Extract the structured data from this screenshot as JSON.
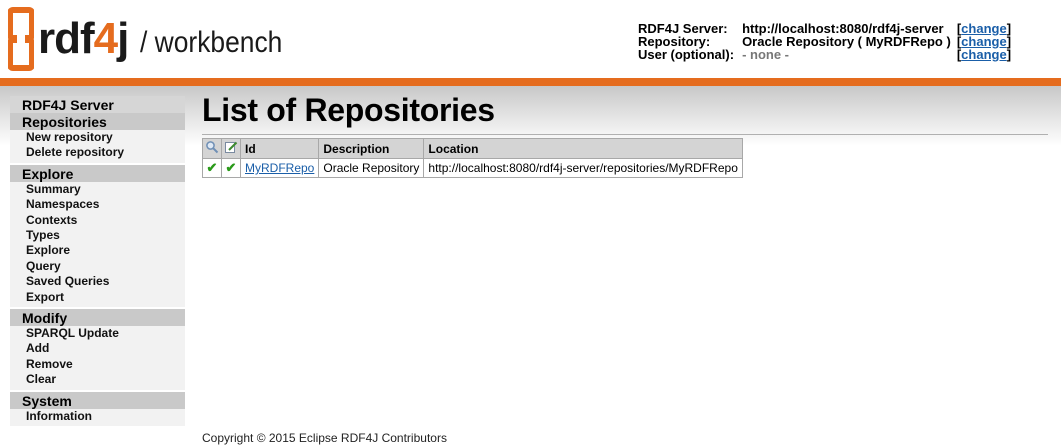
{
  "header": {
    "logo_text_prefix": "rdf",
    "logo_text_four": "4",
    "logo_text_suffix": "j",
    "logo_subtitle": "/ workbench",
    "server_label": "RDF4J Server:",
    "server_value": "http://localhost:8080/rdf4j-server",
    "repository_label": "Repository:",
    "repository_value": "Oracle Repository ( MyRDFRepo )",
    "user_label": "User (optional):",
    "user_value": "- none -",
    "change_label": "change",
    "bracket_open": "[",
    "bracket_close": "]"
  },
  "sidebar": {
    "server_heading": "RDF4J Server",
    "sections": [
      {
        "heading": "Repositories",
        "items": [
          "New repository",
          "Delete repository"
        ]
      },
      {
        "heading": "Explore",
        "items": [
          "Summary",
          "Namespaces",
          "Contexts",
          "Types",
          "Explore",
          "Query",
          "Saved Queries",
          "Export"
        ]
      },
      {
        "heading": "Modify",
        "items": [
          "SPARQL Update",
          "Add",
          "Remove",
          "Clear"
        ]
      },
      {
        "heading": "System",
        "items": [
          "Information"
        ]
      }
    ]
  },
  "main": {
    "title": "List of Repositories",
    "table": {
      "headers": [
        "Id",
        "Description",
        "Location"
      ],
      "rows": [
        {
          "readable": true,
          "writable": true,
          "id": "MyRDFRepo",
          "description": "Oracle Repository",
          "location": "http://localhost:8080/rdf4j-server/repositories/MyRDFRepo"
        }
      ]
    }
  },
  "footer": {
    "copyright": "Copyright © 2015 Eclipse RDF4J Contributors"
  },
  "colors": {
    "accent": "#e56c1e",
    "link": "#1a5ea8",
    "check": "#2a9a1a"
  },
  "icons": {
    "readable_header": "magnifier-icon",
    "writable_header": "edit-icon",
    "row_status": "checkmark-icon"
  }
}
